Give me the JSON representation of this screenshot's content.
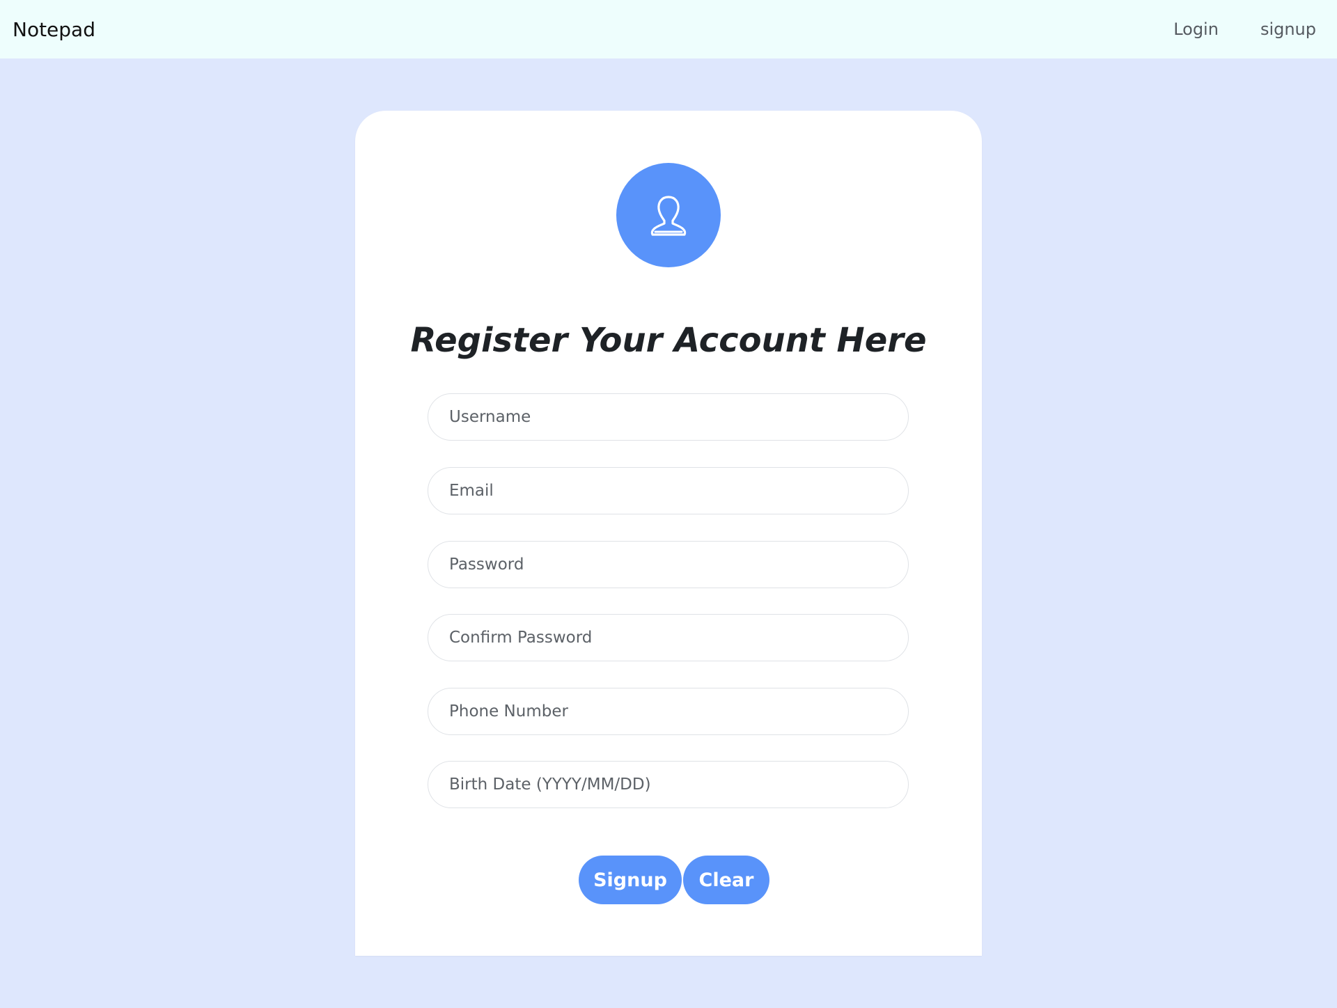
{
  "navbar": {
    "brand": "Notepad",
    "links": [
      {
        "label": "Login"
      },
      {
        "label": "signup"
      }
    ]
  },
  "form": {
    "avatar_icon": "user-icon",
    "title": "Register Your Account Here",
    "fields": {
      "username": {
        "placeholder": "Username",
        "value": ""
      },
      "email": {
        "placeholder": "Email",
        "value": ""
      },
      "password": {
        "placeholder": "Password",
        "value": ""
      },
      "confirm_password": {
        "placeholder": "Confirm Password",
        "value": ""
      },
      "phone": {
        "placeholder": "Phone Number",
        "value": ""
      },
      "birth_date": {
        "placeholder": "Birth Date (YYYY/MM/DD)",
        "value": ""
      }
    },
    "buttons": {
      "signup": "Signup",
      "clear": "Clear"
    }
  },
  "colors": {
    "accent": "#5993fa",
    "page_background": "#dee7fd",
    "navbar_background": "#eefefd",
    "card_background": "#ffffff"
  }
}
